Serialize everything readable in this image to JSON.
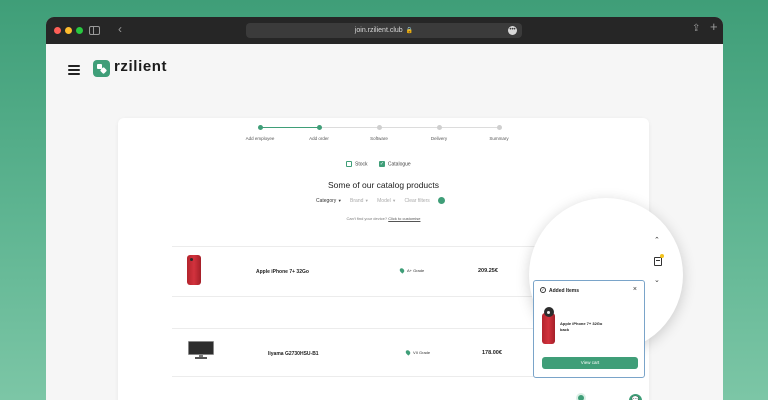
{
  "browser": {
    "url": "join.rzilient.club",
    "lock_icon": "lock-icon",
    "more_icon": "ellipsis-icon"
  },
  "brand": {
    "name": "rzilient",
    "accent": "#3f9e78"
  },
  "stepper": {
    "steps": [
      {
        "label": "Add employee",
        "state": "done"
      },
      {
        "label": "Add order",
        "state": "current"
      },
      {
        "label": "Software",
        "state": "pending"
      },
      {
        "label": "Delivery",
        "state": "pending"
      },
      {
        "label": "Summary",
        "state": "pending"
      }
    ]
  },
  "source_toggles": {
    "stock": {
      "label": "Stock",
      "checked": false
    },
    "catalogue": {
      "label": "Catalogue",
      "checked": true
    }
  },
  "catalog": {
    "title": "Some of our catalog products",
    "filters": [
      {
        "label": "Category",
        "active": true
      },
      {
        "label": "Brand",
        "active": false
      },
      {
        "label": "Model",
        "active": false
      },
      {
        "label": "Clear filters",
        "active": false
      }
    ],
    "hint_prefix": "Can't find your device?",
    "hint_link": "Click to customise",
    "products": [
      {
        "name": "Apple iPhone 7+ 32Go",
        "grade": "A+ Grade",
        "price": "209.25€",
        "image": "red-phone"
      },
      {
        "name": "Iiyama G2730HSU-B1",
        "grade": "VII Grade",
        "price": "178.00€",
        "image": "monitor"
      }
    ]
  },
  "added_items": {
    "title": "Added Items",
    "item_name_line1": "Apple iPhone 7+ 32Go",
    "item_name_line2": "back",
    "view_cart_label": "View cart"
  }
}
